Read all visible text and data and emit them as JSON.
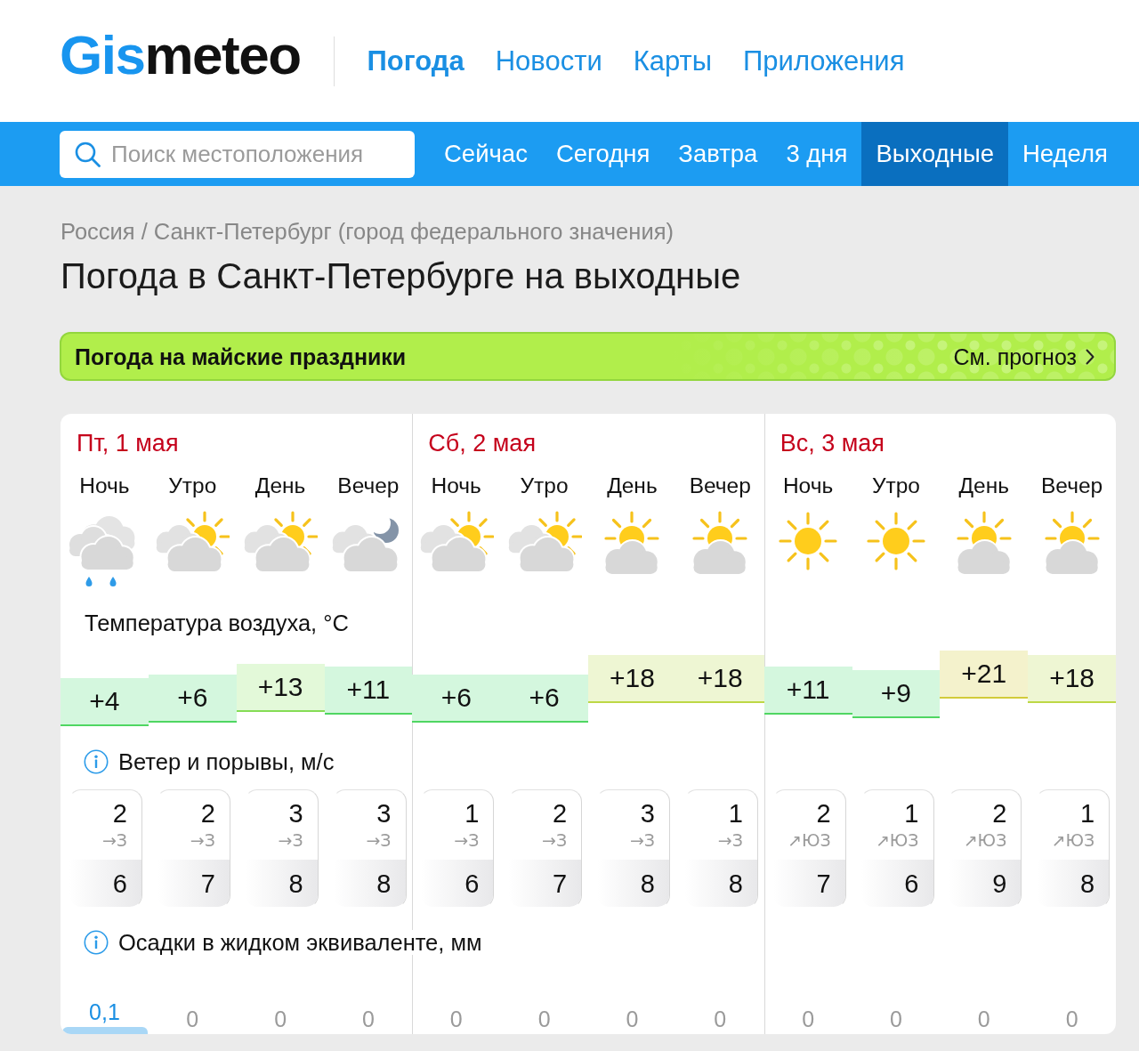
{
  "header": {
    "logo": {
      "accent": "Gis",
      "rest": "meteo"
    },
    "nav": [
      {
        "label": "Погода",
        "selected": true
      },
      {
        "label": "Новости",
        "selected": false
      },
      {
        "label": "Карты",
        "selected": false
      },
      {
        "label": "Приложения",
        "selected": false
      }
    ]
  },
  "tab_bar": {
    "search": {
      "placeholder": "Поиск местоположения"
    },
    "tabs": [
      {
        "label": "Сейчас",
        "selected": false
      },
      {
        "label": "Сегодня",
        "selected": false
      },
      {
        "label": "Завтра",
        "selected": false
      },
      {
        "label": "3 дня",
        "selected": false
      },
      {
        "label": "Выходные",
        "selected": true
      },
      {
        "label": "Неделя",
        "selected": false
      }
    ]
  },
  "breadcrumb": {
    "items": [
      "Россия",
      "Санкт-Петербург (город федерального значения)"
    ],
    "separator": "/"
  },
  "page_title": "Погода в Санкт-Петербурге на выходные",
  "banner": {
    "title": "Погода на майские праздники",
    "link": "См. прогноз"
  },
  "forecast": {
    "days": [
      {
        "date": "Пт, 1 мая",
        "periods": [
          {
            "name": "Ночь",
            "kind": "rain"
          },
          {
            "name": "Утро",
            "kind": "sun-cloud"
          },
          {
            "name": "День",
            "kind": "sun-cloud"
          },
          {
            "name": "Вечер",
            "kind": "moon-cloud"
          }
        ]
      },
      {
        "date": "Сб, 2 мая",
        "periods": [
          {
            "name": "Ночь",
            "kind": "sun-cloud"
          },
          {
            "name": "Утро",
            "kind": "sun-cloud"
          },
          {
            "name": "День",
            "kind": "sun-over-cloud"
          },
          {
            "name": "Вечер",
            "kind": "sun-over-cloud"
          }
        ]
      },
      {
        "date": "Вс, 3 мая",
        "periods": [
          {
            "name": "Ночь",
            "kind": "sun"
          },
          {
            "name": "Утро",
            "kind": "sun"
          },
          {
            "name": "День",
            "kind": "sun-over-cloud"
          },
          {
            "name": "Вечер",
            "kind": "sun-over-cloud"
          }
        ]
      }
    ],
    "temperature": {
      "label": "Температура воздуха, °C",
      "values": [
        "+4",
        "+6",
        "+13",
        "+11",
        "+6",
        "+6",
        "+18",
        "+18",
        "+11",
        "+9",
        "+21",
        "+18"
      ]
    },
    "wind": {
      "label": "Ветер и порывы, м/с",
      "values": [
        {
          "speed": "2",
          "direction": "→З",
          "gust": "6"
        },
        {
          "speed": "2",
          "direction": "→З",
          "gust": "7"
        },
        {
          "speed": "3",
          "direction": "→З",
          "gust": "8"
        },
        {
          "speed": "3",
          "direction": "→З",
          "gust": "8"
        },
        {
          "speed": "1",
          "direction": "→З",
          "gust": "6"
        },
        {
          "speed": "2",
          "direction": "→З",
          "gust": "7"
        },
        {
          "speed": "3",
          "direction": "→З",
          "gust": "8"
        },
        {
          "speed": "1",
          "direction": "→З",
          "gust": "8"
        },
        {
          "speed": "2",
          "direction": "↗ЮЗ",
          "gust": "7"
        },
        {
          "speed": "1",
          "direction": "↗ЮЗ",
          "gust": "6"
        },
        {
          "speed": "2",
          "direction": "↗ЮЗ",
          "gust": "9"
        },
        {
          "speed": "1",
          "direction": "↗ЮЗ",
          "gust": "8"
        }
      ]
    },
    "precipitation": {
      "label": "Осадки в жидком эквиваленте, мм",
      "values": [
        {
          "amount": "0,1",
          "wet": true
        },
        {
          "amount": "0",
          "wet": false
        },
        {
          "amount": "0",
          "wet": false
        },
        {
          "amount": "0",
          "wet": false
        },
        {
          "amount": "0",
          "wet": false
        },
        {
          "amount": "0",
          "wet": false
        },
        {
          "amount": "0",
          "wet": false
        },
        {
          "amount": "0",
          "wet": false
        },
        {
          "amount": "0",
          "wet": false
        },
        {
          "amount": "0",
          "wet": false
        },
        {
          "amount": "0",
          "wet": false
        },
        {
          "amount": "0",
          "wet": false
        }
      ]
    }
  }
}
